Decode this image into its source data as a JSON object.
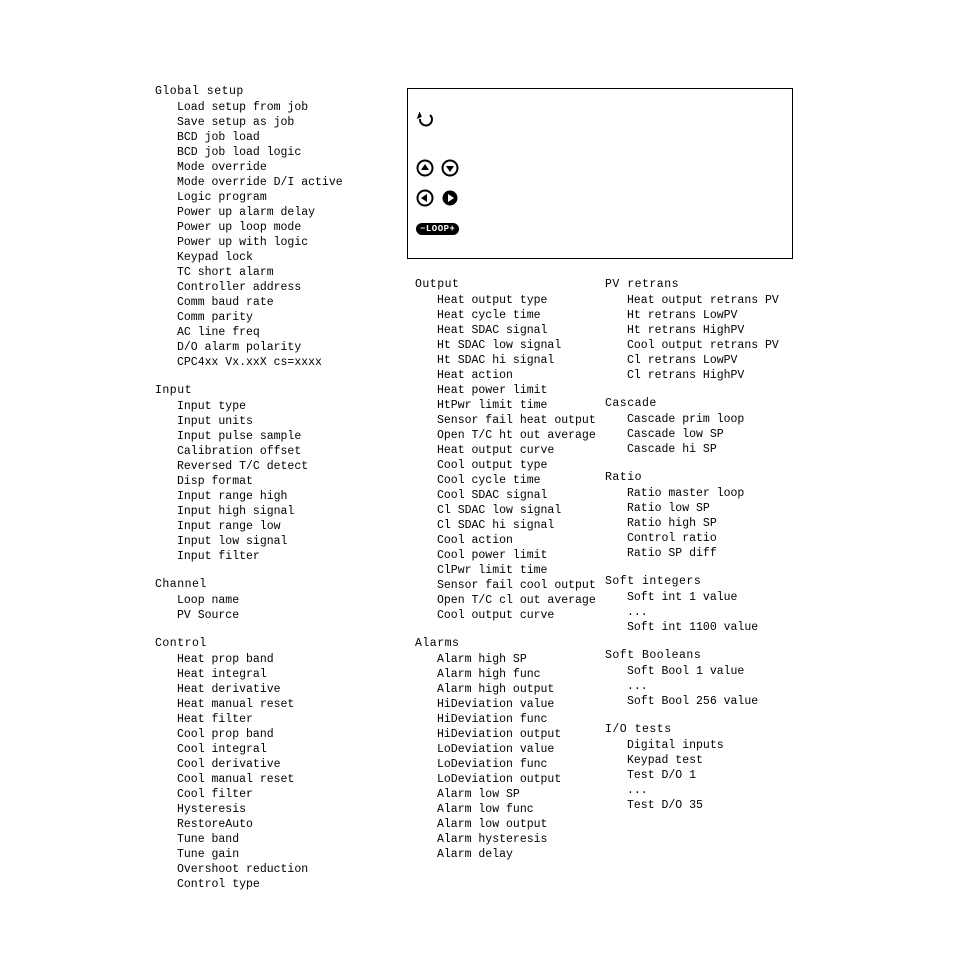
{
  "col1": {
    "s0": {
      "head": "Global setup",
      "i": [
        "Load setup from job",
        "Save setup as job",
        "BCD job load",
        "BCD job load logic",
        "Mode override",
        "Mode override D/I active",
        "Logic program",
        "Power up alarm delay",
        "Power up loop mode",
        "Power up with logic",
        "Keypad lock",
        "TC short alarm",
        "Controller address",
        "Comm baud rate",
        "Comm parity",
        "AC line freq",
        "D/O alarm polarity",
        "CPC4xx Vx.xxX cs=xxxx"
      ]
    },
    "s1": {
      "head": "Input",
      "i": [
        "Input type",
        "Input units",
        "Input pulse sample",
        "Calibration offset",
        "Reversed T/C detect",
        "Disp format",
        "Input range high",
        "Input high signal",
        "Input range low",
        "Input low signal",
        "Input filter"
      ]
    },
    "s2": {
      "head": "Channel",
      "i": [
        "Loop name",
        "PV Source"
      ]
    },
    "s3": {
      "head": "Control",
      "i": [
        "Heat prop band",
        "Heat integral",
        "Heat derivative",
        "Heat manual reset",
        "Heat filter",
        "Cool prop band",
        "Cool integral",
        "Cool derivative",
        "Cool manual reset",
        "Cool filter",
        "Hysteresis",
        "RestoreAuto",
        "Tune band",
        "Tune gain",
        "Overshoot reduction",
        "Control type"
      ]
    }
  },
  "col2": {
    "s0": {
      "head": "Output",
      "i": [
        "Heat output type",
        "Heat cycle time",
        "Heat SDAC signal",
        "Ht SDAC low signal",
        "Ht SDAC hi signal",
        "Heat action",
        "Heat power limit",
        "HtPwr limit time",
        "Sensor fail heat output",
        "Open T/C ht out average",
        "Heat output curve",
        "Cool output type",
        "Cool cycle time",
        "Cool SDAC signal",
        "Cl SDAC low signal",
        "Cl SDAC hi signal",
        "Cool action",
        "Cool power limit",
        "ClPwr limit time",
        "Sensor fail cool output",
        "Open T/C cl out average",
        "Cool output curve"
      ]
    },
    "s1": {
      "head": "Alarms",
      "i": [
        "Alarm high SP",
        "Alarm high func",
        "Alarm high output",
        "HiDeviation value",
        "HiDeviation func",
        "HiDeviation output",
        "LoDeviation value",
        "LoDeviation func",
        "LoDeviation output",
        "Alarm low SP",
        "Alarm low func",
        "Alarm low output",
        "Alarm hysteresis",
        "Alarm delay"
      ]
    }
  },
  "col3": {
    "s0": {
      "head": "PV retrans",
      "i": [
        "Heat output retrans PV",
        "Ht retrans LowPV",
        "Ht retrans HighPV",
        "Cool output retrans PV",
        "Cl retrans LowPV",
        "Cl retrans HighPV"
      ]
    },
    "s1": {
      "head": "Cascade",
      "i": [
        "Cascade prim loop",
        "Cascade low SP",
        "Cascade hi SP"
      ]
    },
    "s2": {
      "head": "Ratio",
      "i": [
        "Ratio master loop",
        "Ratio low SP",
        "Ratio high SP",
        "Control ratio",
        "Ratio SP diff"
      ]
    },
    "s3": {
      "head": "Soft integers",
      "i": [
        "Soft int 1 value",
        "...",
        "Soft int 1100 value"
      ]
    },
    "s4": {
      "head": "Soft Booleans",
      "i": [
        "Soft Bool 1 value",
        "...",
        "Soft Bool 256 value"
      ]
    },
    "s5": {
      "head": "I/O tests",
      "i": [
        "Digital inputs",
        "Keypad test",
        "Test D/O 1",
        "...",
        "Test D/O 35"
      ]
    }
  },
  "panel": {
    "loop_label": "LOOP"
  }
}
